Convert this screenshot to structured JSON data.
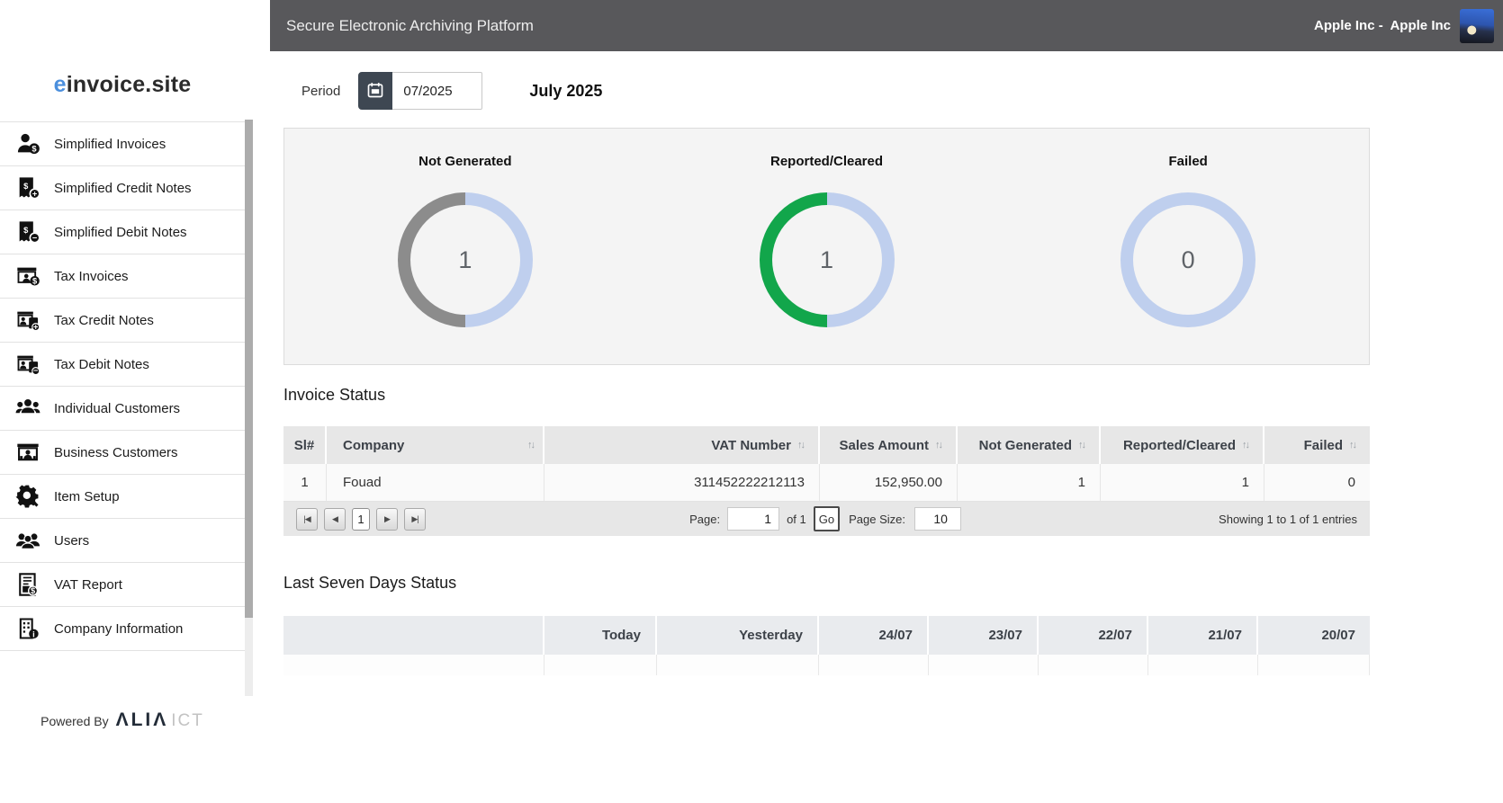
{
  "topbar": {
    "title": "Secure Electronic Archiving Platform",
    "company_label": "Apple Inc -  Apple Inc"
  },
  "sidebar": {
    "logo_accent": "e",
    "logo_rest": "invoice.site",
    "items": [
      {
        "label": "Simplified Invoices",
        "icon": "person-invoice-icon"
      },
      {
        "label": "Simplified Credit Notes",
        "icon": "receipt-plus-icon"
      },
      {
        "label": "Simplified Debit Notes",
        "icon": "receipt-minus-icon"
      },
      {
        "label": "Tax Invoices",
        "icon": "register-invoice-icon"
      },
      {
        "label": "Tax Credit Notes",
        "icon": "register-receipt-plus-icon"
      },
      {
        "label": "Tax Debit Notes",
        "icon": "register-receipt-minus-icon"
      },
      {
        "label": "Individual Customers",
        "icon": "people-group-icon"
      },
      {
        "label": "Business Customers",
        "icon": "storefront-person-icon"
      },
      {
        "label": "Item Setup",
        "icon": "gear-wrench-icon"
      },
      {
        "label": "Users",
        "icon": "users-icon"
      },
      {
        "label": "VAT Report",
        "icon": "document-dollar-icon"
      },
      {
        "label": "Company Information",
        "icon": "building-info-icon"
      }
    ],
    "powered_by": "Powered By",
    "brand_name": "ΛLIΛ",
    "brand_suffix": "ICT"
  },
  "period": {
    "label": "Period",
    "value": "07/2025",
    "month_title": "July 2025"
  },
  "donut_track": "#bfcfee",
  "donuts": [
    {
      "title": "Not Generated",
      "value": "1",
      "fill_percent": 50,
      "color": "#8c8c8c"
    },
    {
      "title": "Reported/Cleared",
      "value": "1",
      "fill_percent": 50,
      "color": "#12a64b"
    },
    {
      "title": "Failed",
      "value": "0",
      "fill_percent": 0,
      "color": "#bfcfee"
    }
  ],
  "invoice_status": {
    "heading": "Invoice Status",
    "columns": [
      "Sl#",
      "Company",
      "VAT Number",
      "Sales Amount",
      "Not Generated",
      "Reported/Cleared",
      "Failed"
    ],
    "rows": [
      [
        "1",
        "Fouad",
        "311452222212113",
        "152,950.00",
        "1",
        "1",
        "0"
      ]
    ],
    "pagination": {
      "nav": [
        "|◀",
        "◀",
        "▶",
        "▶|"
      ],
      "current_page": "1",
      "page_label": "Page:",
      "page_value": "1",
      "of_label": "of 1",
      "go_label": "Go",
      "size_label": "Page Size:",
      "size_value": "10",
      "showing": "Showing 1 to 1 of 1 entries"
    }
  },
  "last_seven_days": {
    "heading": "Last Seven Days Status",
    "columns": [
      "",
      "Today",
      "Yesterday",
      "24/07",
      "23/07",
      "22/07",
      "21/07",
      "20/07"
    ]
  },
  "icons": {
    "sort": "↑↓"
  },
  "colors": {
    "topbar_bg": "#58585b",
    "logo_accent_blue": "#4b8fdd",
    "donut_gray": "#8c8c8c",
    "donut_green": "#12a64b",
    "donut_track_blue": "#bfcfee",
    "calendar_button_bg": "#3e4752"
  }
}
